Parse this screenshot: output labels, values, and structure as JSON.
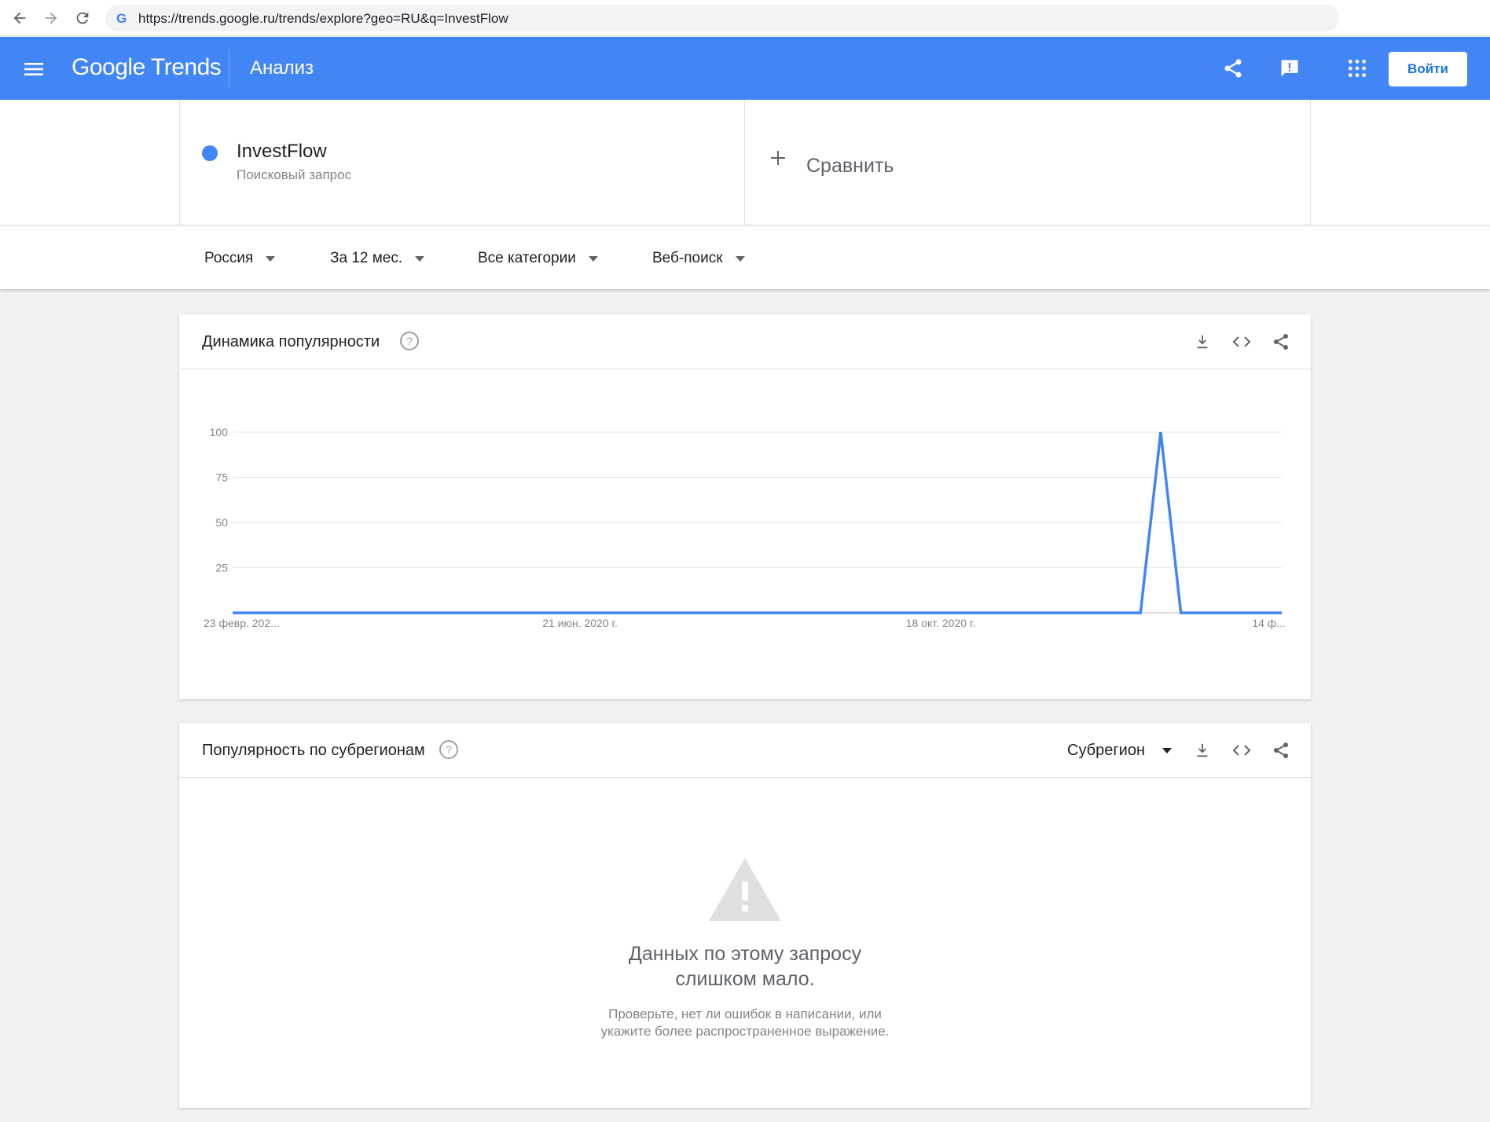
{
  "browser": {
    "url": "https://trends.google.ru/trends/explore?geo=RU&q=InvestFlow",
    "favicon_letter": "G"
  },
  "header": {
    "logo": "Google Trends",
    "title": "Анализ",
    "login_label": "Войти",
    "color": "#4285f4"
  },
  "term": {
    "name": "InvestFlow",
    "type": "Поисковый запрос",
    "color": "#4285f4"
  },
  "compare": {
    "label": "Сравнить"
  },
  "filters": {
    "region": "Россия",
    "period": "За 12 мес.",
    "category": "Все категории",
    "search_type": "Веб-поиск"
  },
  "interest_card": {
    "title": "Динамика популярности"
  },
  "subregion_card": {
    "title": "Популярность по субрегионам",
    "selector": "Субрегион",
    "empty_title_line1": "Данных по этому запросу",
    "empty_title_line2": "слишком мало.",
    "empty_sub_line1": "Проверьте, нет ли ошибок в написании, или",
    "empty_sub_line2": "укажите более распространенное выражение."
  },
  "chart_data": {
    "type": "line",
    "x_tick_labels": [
      "23 февр. 202...",
      "21 июн. 2020 г.",
      "18 окт. 2020 г.",
      "14 ф..."
    ],
    "y_ticks": [
      25,
      50,
      75,
      100
    ],
    "ylim": [
      0,
      100
    ],
    "grid": true,
    "series": [
      {
        "color": "#4285f4",
        "x": [
          0,
          45,
          46,
          47,
          48,
          52
        ],
        "values": [
          0,
          0,
          100,
          0,
          0,
          0
        ]
      }
    ],
    "xlim": [
      0,
      52
    ]
  }
}
